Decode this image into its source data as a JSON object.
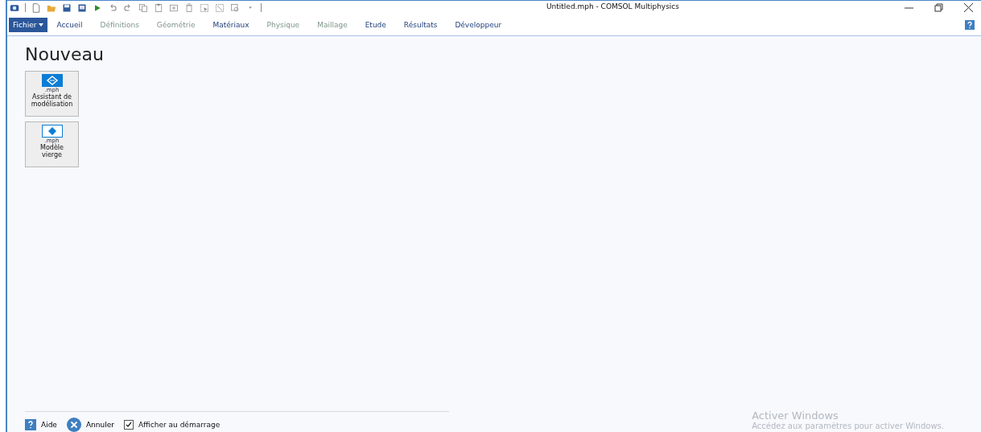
{
  "window": {
    "title": "Untitled.mph - COMSOL Multiphysics"
  },
  "tabs": [
    {
      "label": "Fichier",
      "kind": "file",
      "disabled": false
    },
    {
      "label": "Accueil",
      "kind": "tab",
      "disabled": false
    },
    {
      "label": "Définitions",
      "kind": "tab",
      "disabled": true
    },
    {
      "label": "Géométrie",
      "kind": "tab",
      "disabled": true
    },
    {
      "label": "Matériaux",
      "kind": "tab",
      "disabled": false
    },
    {
      "label": "Physique",
      "kind": "tab",
      "disabled": true
    },
    {
      "label": "Maillage",
      "kind": "tab",
      "disabled": true
    },
    {
      "label": "Etude",
      "kind": "tab",
      "disabled": false
    },
    {
      "label": "Résultats",
      "kind": "tab",
      "disabled": false
    },
    {
      "label": "Développeur",
      "kind": "tab",
      "disabled": false
    }
  ],
  "heading": "Nouveau",
  "new_options": [
    {
      "extension": ".mph",
      "label_lines": [
        "Assistant de",
        "modélisation"
      ],
      "kind": "wizard"
    },
    {
      "extension": ".mph",
      "label_lines": [
        "Modèle",
        "vierge"
      ],
      "kind": "blank"
    }
  ],
  "footer": {
    "help": "Aide",
    "cancel": "Annuler",
    "startup": {
      "label": "Afficher au démarrage",
      "checked": true
    }
  },
  "activation": {
    "title": "Activer Windows",
    "message": "Accédez aux paramètres pour activer Windows."
  }
}
